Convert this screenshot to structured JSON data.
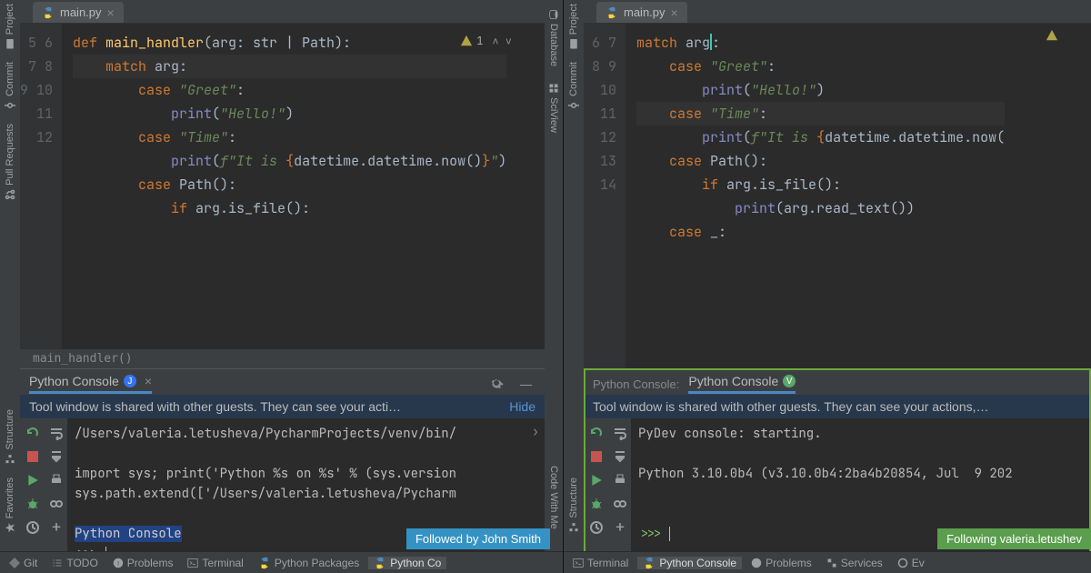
{
  "left": {
    "sidebarTop": [
      "Project",
      "Commit",
      "Pull Requests"
    ],
    "sidebarBottom": [
      "Structure",
      "Favorites"
    ],
    "rightStrip": [
      "Database",
      "SciView",
      "Code With Me"
    ],
    "tab": "main.py",
    "warning": "1",
    "gutterStart": 5,
    "gutterEnd": 12,
    "breadcrumb": "main_handler()",
    "code": [
      [
        [
          "kw",
          "def "
        ],
        [
          "fn",
          "main_handler"
        ],
        [
          "p",
          "(arg: str | Path):"
        ]
      ],
      [
        [
          "kw",
          "    match "
        ],
        [
          "p",
          "arg:"
        ]
      ],
      [
        [
          "kw",
          "        case "
        ],
        [
          "str",
          "\"Greet\""
        ],
        [
          "p",
          ":"
        ]
      ],
      [
        [
          "bi",
          "            print"
        ],
        [
          "p",
          "("
        ],
        [
          "str",
          "\"Hello!\""
        ],
        [
          "p",
          ")"
        ]
      ],
      [
        [
          "kw",
          "        case "
        ],
        [
          "str",
          "\"Time\""
        ],
        [
          "p",
          ":"
        ]
      ],
      [
        [
          "bi",
          "            print"
        ],
        [
          "p",
          "("
        ],
        [
          "str",
          "f\"It is "
        ],
        [
          "kw",
          "{"
        ],
        [
          "p",
          "datetime.datetime.now()"
        ],
        [
          "kw",
          "}"
        ],
        [
          "str",
          "\""
        ],
        [
          "p",
          ")"
        ]
      ],
      [
        [
          "kw",
          "        case "
        ],
        [
          "p",
          "Path():"
        ]
      ],
      [
        [
          "kw",
          "            if "
        ],
        [
          "p",
          "arg.is_file():"
        ]
      ]
    ],
    "consoleTab": "Python Console",
    "banner": "Tool window is shared with other guests. They can see your acti…",
    "hide": "Hide",
    "consoleLines": [
      "/Users/valeria.letusheva/PycharmProjects/venv/bin/",
      "",
      "import sys; print('Python %s on %s' % (sys.version",
      "sys.path.extend(['/Users/valeria.letusheva/Pycharm",
      "",
      "Python Console",
      ">>> "
    ],
    "followBadge": "Followed by John Smith",
    "bottomBar": [
      "Git",
      "TODO",
      "Problems",
      "Terminal",
      "Python Packages",
      "Python Co"
    ]
  },
  "right": {
    "sidebarTop": [
      "Project",
      "Commit"
    ],
    "sidebarBottom": [
      "Structure"
    ],
    "tab": "main.py",
    "gutterStart": 6,
    "gutterEnd": 14,
    "code": [
      [
        [
          "kw",
          "match "
        ],
        [
          "p",
          "arg"
        ],
        [
          "p",
          ":"
        ]
      ],
      [
        [
          "kw",
          "    case "
        ],
        [
          "str",
          "\"Greet\""
        ],
        [
          "p",
          ":"
        ]
      ],
      [
        [
          "bi",
          "        print"
        ],
        [
          "p",
          "("
        ],
        [
          "str",
          "\"Hello!\""
        ],
        [
          "p",
          ")"
        ]
      ],
      [
        [
          "kw",
          "    case "
        ],
        [
          "str",
          "\"Time\""
        ],
        [
          "p",
          ":"
        ]
      ],
      [
        [
          "bi",
          "        print"
        ],
        [
          "p",
          "("
        ],
        [
          "str",
          "f\"It is "
        ],
        [
          "kw",
          "{"
        ],
        [
          "p",
          "datetime.datetime.now("
        ],
        [
          "kw",
          ""
        ]
      ],
      [
        [
          "kw",
          "    case "
        ],
        [
          "p",
          "Path():"
        ]
      ],
      [
        [
          "kw",
          "        if "
        ],
        [
          "p",
          "arg.is_file():"
        ]
      ],
      [
        [
          "bi",
          "            print"
        ],
        [
          "p",
          "(arg.read_text())"
        ]
      ],
      [
        [
          "kw",
          "    case "
        ],
        [
          "p",
          "_:"
        ]
      ]
    ],
    "consoleLabel": "Python Console:",
    "consoleTab": "Python Console",
    "banner": "Tool window is shared with other guests. They can see your actions,…",
    "consoleLines": [
      "PyDev console: starting.",
      "",
      "Python 3.10.0b4 (v3.10.0b4:2ba4b20854, Jul  9 202",
      "",
      "",
      ">>> "
    ],
    "followBadge": "Following valeria.letushev",
    "bottomBar": [
      "Terminal",
      "Python Console",
      "Problems",
      "Services",
      "Ev"
    ]
  }
}
